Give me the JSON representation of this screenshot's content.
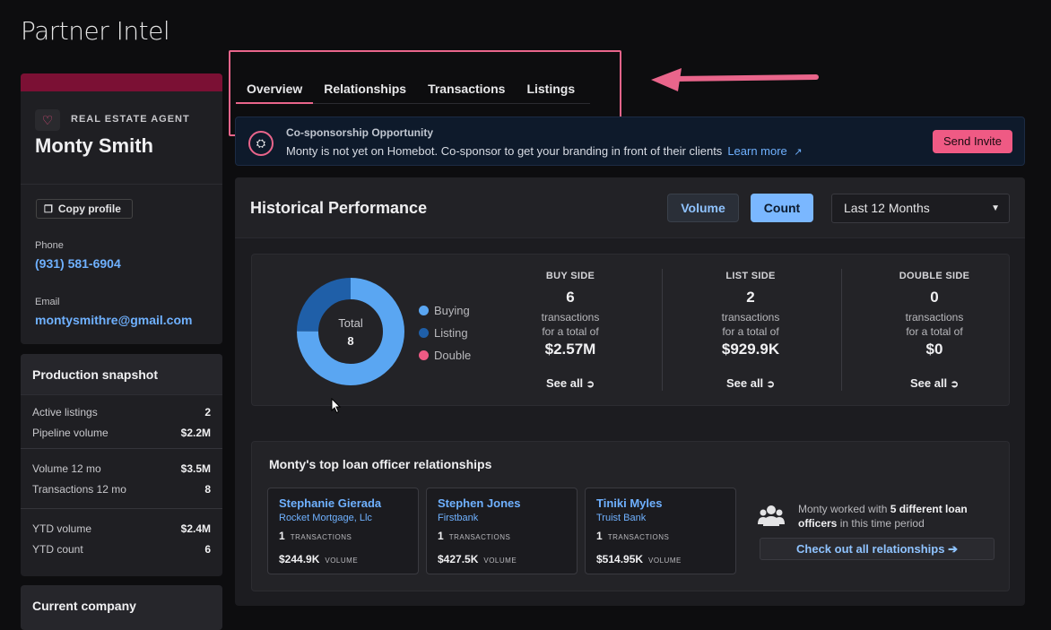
{
  "page": {
    "title": "Partner Intel"
  },
  "agent": {
    "role": "REAL ESTATE AGENT",
    "name": "Monty Smith",
    "copy_label": "Copy profile",
    "phone_label": "Phone",
    "phone": "(931) 581-6904",
    "email_label": "Email",
    "email": "montysmithre@gmail.com",
    "icon": "heart-icon"
  },
  "snapshot": {
    "title": "Production snapshot",
    "groups": [
      [
        {
          "label": "Active listings",
          "value": "2"
        },
        {
          "label": "Pipeline volume",
          "value": "$2.2M"
        }
      ],
      [
        {
          "label": "Volume 12 mo",
          "value": "$3.5M"
        },
        {
          "label": "Transactions 12 mo",
          "value": "8"
        }
      ],
      [
        {
          "label": "YTD volume",
          "value": "$2.4M"
        },
        {
          "label": "YTD count",
          "value": "6"
        }
      ]
    ]
  },
  "company": {
    "title": "Current company"
  },
  "tabs": [
    "Overview",
    "Relationships",
    "Transactions",
    "Listings"
  ],
  "banner": {
    "title": "Co-sponsorship Opportunity",
    "text": "Monty is not yet on Homebot. Co-sponsor to get your branding in front of their clients",
    "learn_more": "Learn more",
    "send_label": "Send Invite",
    "icon": "robot-icon"
  },
  "historical": {
    "title": "Historical Performance",
    "volume_label": "Volume",
    "count_label": "Count",
    "period": "Last 12 Months",
    "donut": {
      "total_label": "Total",
      "total": "8",
      "segments": [
        {
          "name": "Buying",
          "value": 6,
          "color": "#5aa6f2"
        },
        {
          "name": "Listing",
          "value": 2,
          "color": "#1f5fa8"
        },
        {
          "name": "Double",
          "value": 0,
          "color": "#ef5a84"
        }
      ]
    },
    "columns": [
      {
        "heading": "BUY SIDE",
        "count": "6",
        "line1": "transactions",
        "line2": "for a total of",
        "amount": "$2.57M",
        "see_all": "See all"
      },
      {
        "heading": "LIST SIDE",
        "count": "2",
        "line1": "transactions",
        "line2": "for a total of",
        "amount": "$929.9K",
        "see_all": "See all"
      },
      {
        "heading": "DOUBLE SIDE",
        "count": "0",
        "line1": "transactions",
        "line2": "for a total of",
        "amount": "$0",
        "see_all": "See all"
      }
    ]
  },
  "loan": {
    "title": "Monty's top loan officer relationships",
    "tx_label": "TRANSACTIONS",
    "vol_label": "VOLUME",
    "officers": [
      {
        "name": "Stephanie Gierada",
        "company": "Rocket Mortgage, Llc",
        "tx": "1",
        "volume": "$244.9K"
      },
      {
        "name": "Stephen Jones",
        "company": "Firstbank",
        "tx": "1",
        "volume": "$427.5K"
      },
      {
        "name": "Tiniki Myles",
        "company": "Truist Bank",
        "tx": "1",
        "volume": "$514.95K"
      }
    ],
    "summary_pre": "Monty worked with ",
    "summary_bold": "5 different loan officers",
    "summary_post": " in this time period",
    "check_label": "Check out all relationships"
  },
  "colors": {
    "accent_pink": "#e9658b",
    "accent_blue": "#6fb1ff",
    "band": "#7b1034"
  }
}
